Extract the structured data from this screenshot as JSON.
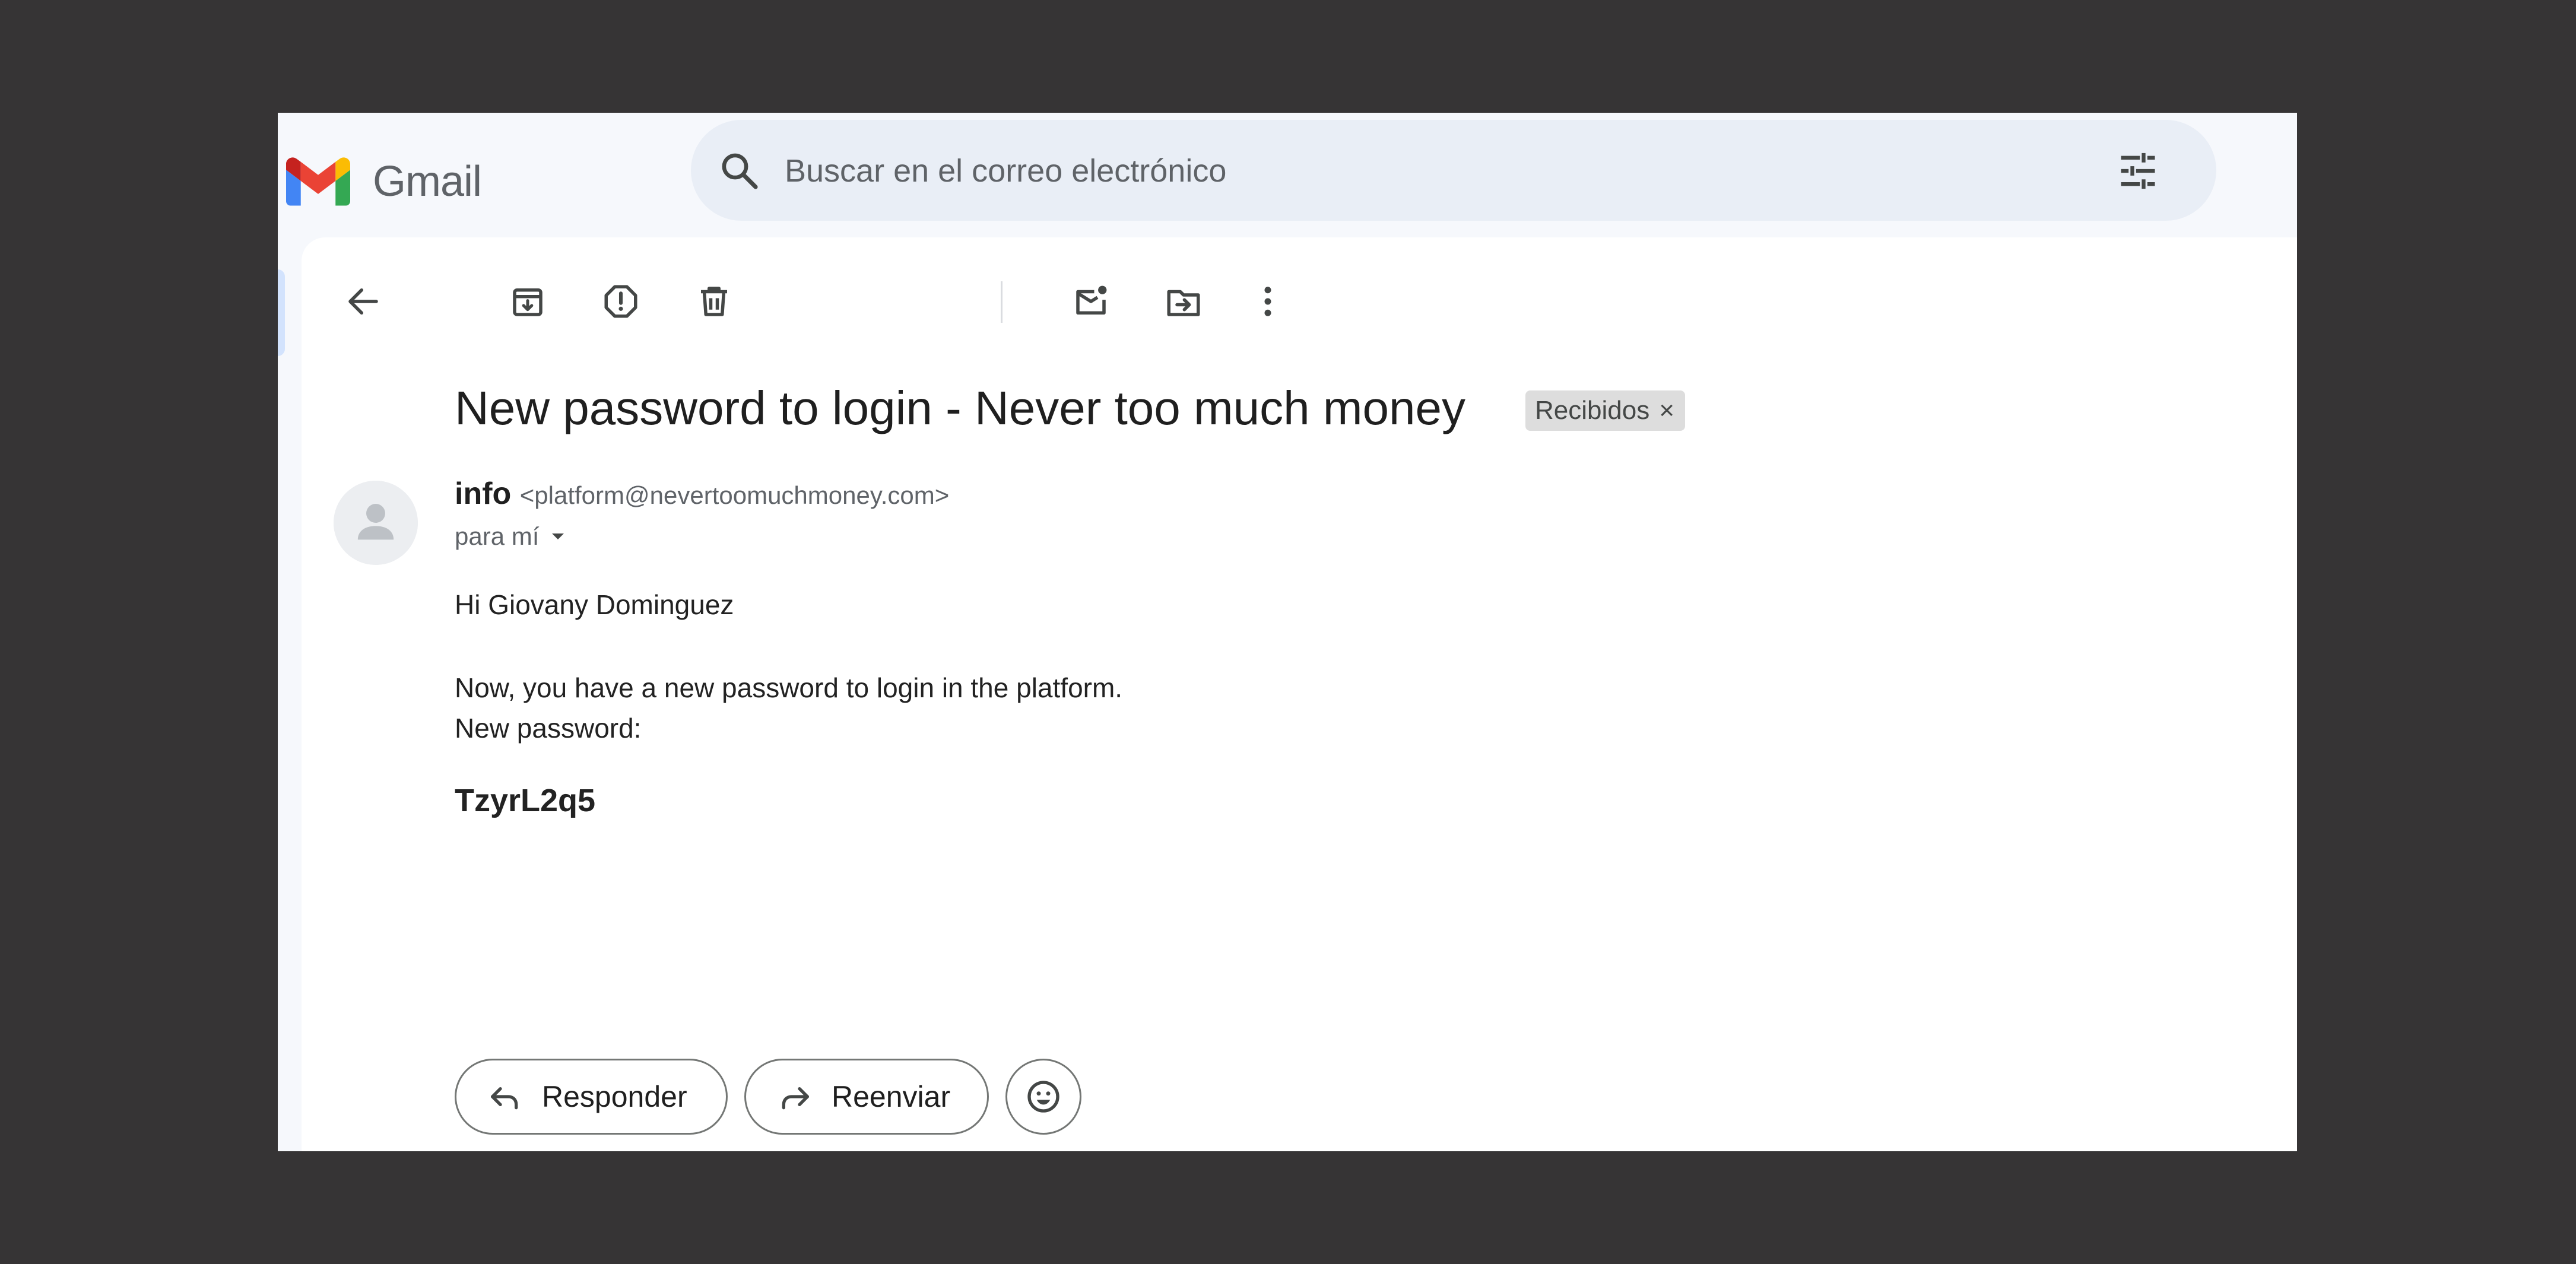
{
  "header": {
    "logo_text": "Gmail",
    "search_placeholder": "Buscar en el correo electrónico"
  },
  "toolbar": {
    "icons": [
      "back-arrow-icon",
      "archive-icon",
      "report-spam-icon",
      "delete-icon",
      "mark-unread-icon",
      "move-to-icon",
      "more-options-icon"
    ]
  },
  "email": {
    "subject": "New password to login - Never too much money",
    "label": "Recibidos",
    "label_remove": "×",
    "sender_name": "info",
    "sender_email": "<platform@nevertoomuchmoney.com>",
    "recipient": "para mí",
    "body": {
      "greeting": "Hi Giovany Dominguez",
      "line1": "Now, you have a new password to login in the platform.",
      "line2": "New password:",
      "password": "TzyrL2q5"
    }
  },
  "actions": {
    "reply_label": "Responder",
    "forward_label": "Reenviar"
  },
  "colors": {
    "backdrop": "#363435",
    "header_bg": "#f6f8fc",
    "search_bg": "#e9eef6",
    "panel_bg": "#ffffff",
    "icon": "#444746",
    "gmail_red": "#ea4335",
    "gmail_blue": "#4285f4",
    "gmail_green": "#34a853",
    "gmail_yellow": "#fbbc04",
    "gmail_dark_red": "#c5221f"
  }
}
